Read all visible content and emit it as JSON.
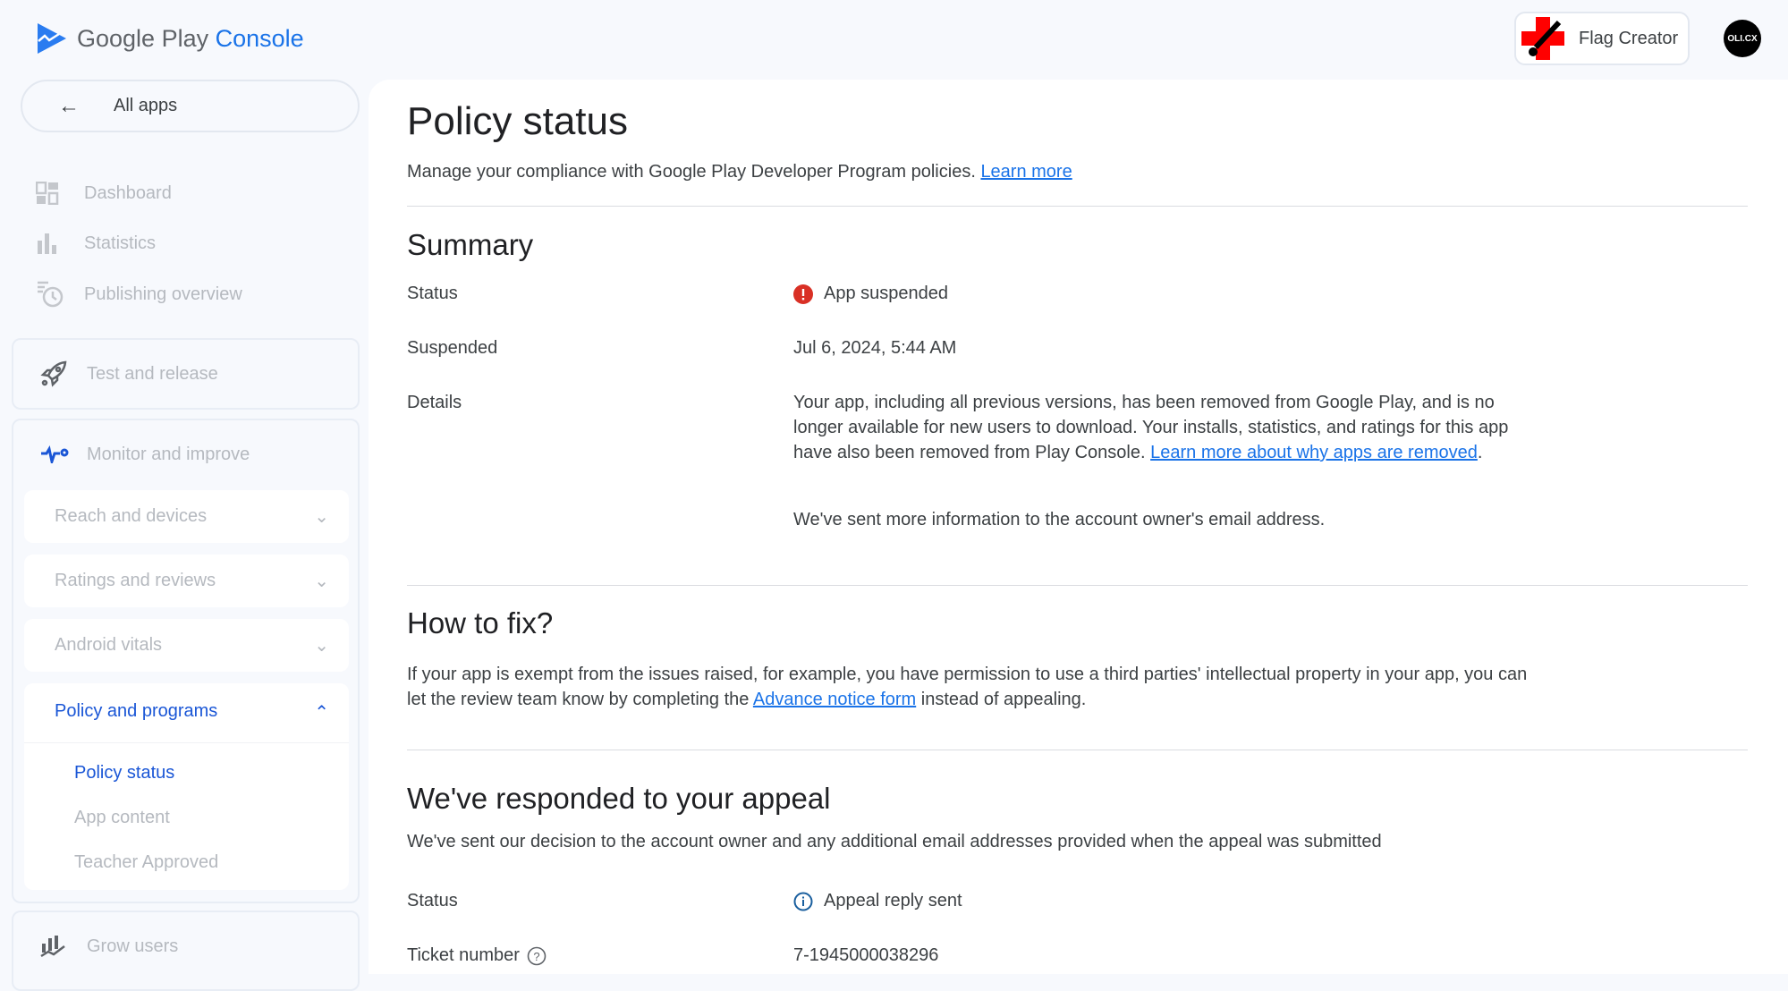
{
  "header": {
    "brand_main": "Google Play",
    "brand_accent": "Console",
    "app_name": "Flag Creator",
    "account_initials": "OLI.CX"
  },
  "sidebar": {
    "all_apps": "All apps",
    "items": [
      {
        "label": "Dashboard",
        "icon": "dashboard-icon"
      },
      {
        "label": "Statistics",
        "icon": "bar-chart-icon"
      },
      {
        "label": "Publishing overview",
        "icon": "publishing-clock-icon"
      }
    ],
    "test_release": "Test and release",
    "monitor": "Monitor and improve",
    "groups": [
      {
        "label": "Reach and devices"
      },
      {
        "label": "Ratings and reviews"
      },
      {
        "label": "Android vitals"
      },
      {
        "label": "Policy and programs"
      }
    ],
    "policy_sub": [
      "Policy status",
      "App content",
      "Teacher Approved"
    ],
    "grow": "Grow users"
  },
  "main": {
    "title": "Policy status",
    "subtitle": "Manage your compliance with Google Play Developer Program policies.",
    "learn_more": "Learn more",
    "summary": {
      "heading": "Summary",
      "status_label": "Status",
      "status_value": "App suspended",
      "suspended_label": "Suspended",
      "suspended_value": "Jul 6, 2024, 5:44 AM",
      "details_label": "Details",
      "details_text": "Your app, including all previous versions, has been removed from Google Play, and is no longer available for new users to download. Your installs, statistics, and ratings for this app have also been removed from Play Console.",
      "details_link": "Learn more about why apps are removed",
      "details_end": ".",
      "details_note": "We've sent more information to the account owner's email address."
    },
    "fix": {
      "heading": "How to fix?",
      "text_before": "If your app is exempt from the issues raised, for example, you have permission to use a third parties' intellectual property in your app, you can let the review team know by completing the",
      "link": "Advance notice form",
      "text_after": "instead of appealing."
    },
    "appeal": {
      "heading": "We've responded to your appeal",
      "text": "We've sent our decision to the account owner and any additional email addresses provided when the appeal was submitted",
      "status_label": "Status",
      "status_value": "Appeal reply sent",
      "ticket_label": "Ticket number",
      "ticket_value": "7-1945000038296"
    }
  },
  "colors": {
    "accent": "#1a73e8",
    "error": "#d93025",
    "info": "#1a5f9e"
  }
}
